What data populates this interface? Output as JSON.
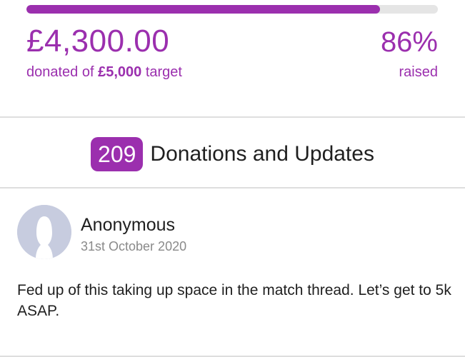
{
  "progress": {
    "fraction_raised": 0.86,
    "fill_color": "#9b2fae",
    "track_color": "#e5e5e5"
  },
  "totals": {
    "amount_donated": "£4,300.00",
    "donated_of_prefix": "donated of",
    "target_amount": "£5,000",
    "target_suffix": "target",
    "percent_raised": "86%",
    "raised_label": "raised"
  },
  "donations_section": {
    "count": "209",
    "title": "Donations and Updates"
  },
  "donations": [
    {
      "donor_name": "Anonymous",
      "date": "31st October 2020",
      "message": "Fed up of this taking up space in the match thread. Let’s get to 5k ASAP.",
      "avatar_icon": "anonymous-user-silhouette-icon"
    }
  ],
  "colors": {
    "accent": "#9b2fae",
    "avatar_background": "#c7ccdf",
    "divider": "#dedede",
    "muted_text": "#8a8a8a"
  }
}
